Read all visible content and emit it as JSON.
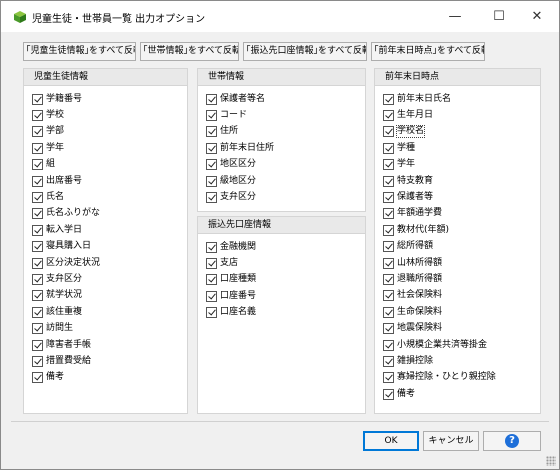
{
  "window": {
    "title": "児童生徒・世帯員一覧  出力オプション",
    "minimize_glyph": "—",
    "maximize_glyph": "☐",
    "close_glyph": "✕",
    "icon": "app-cube-icon"
  },
  "toolbar": {
    "btn_students": "｢児童生徒情報｣をすべて反転",
    "btn_household": "｢世帯情報｣をすべて反転",
    "btn_bank": "｢振込先口座情報｣をすべて反転",
    "btn_prevyear": "｢前年末日時点｣をすべて反転"
  },
  "panels": {
    "students": {
      "title": "児童生徒情報",
      "items": [
        {
          "label": "学籍番号",
          "checked": true
        },
        {
          "label": "学校",
          "checked": true
        },
        {
          "label": "学部",
          "checked": true
        },
        {
          "label": "学年",
          "checked": true
        },
        {
          "label": "組",
          "checked": true
        },
        {
          "label": "出席番号",
          "checked": true
        },
        {
          "label": "氏名",
          "checked": true
        },
        {
          "label": "氏名ふりがな",
          "checked": true
        },
        {
          "label": "転入学日",
          "checked": true
        },
        {
          "label": "寝具購入日",
          "checked": true
        },
        {
          "label": "区分決定状況",
          "checked": true
        },
        {
          "label": "支弁区分",
          "checked": true
        },
        {
          "label": "就学状況",
          "checked": true
        },
        {
          "label": "該住重複",
          "checked": true
        },
        {
          "label": "訪問生",
          "checked": true
        },
        {
          "label": "障害者手帳",
          "checked": true
        },
        {
          "label": "措置費受給",
          "checked": true
        },
        {
          "label": "備考",
          "checked": true
        }
      ]
    },
    "household": {
      "title": "世帯情報",
      "items": [
        {
          "label": "保護者等名",
          "checked": true
        },
        {
          "label": "コード",
          "checked": true
        },
        {
          "label": "住所",
          "checked": true
        },
        {
          "label": "前年末日住所",
          "checked": true
        },
        {
          "label": "地区区分",
          "checked": true
        },
        {
          "label": "級地区分",
          "checked": true
        },
        {
          "label": "支弁区分",
          "checked": true
        }
      ]
    },
    "bank": {
      "title": "振込先口座情報",
      "items": [
        {
          "label": "金融機関",
          "checked": true
        },
        {
          "label": "支店",
          "checked": true
        },
        {
          "label": "口座種類",
          "checked": true
        },
        {
          "label": "口座番号",
          "checked": true
        },
        {
          "label": "口座名義",
          "checked": true
        }
      ]
    },
    "prevyear": {
      "title": "前年末日時点",
      "items": [
        {
          "label": "前年末日氏名",
          "checked": true
        },
        {
          "label": "生年月日",
          "checked": true
        },
        {
          "label": "学校名",
          "checked": true
        },
        {
          "label": "学種",
          "checked": true
        },
        {
          "label": "学年",
          "checked": true
        },
        {
          "label": "特支教育",
          "checked": true
        },
        {
          "label": "保護者等",
          "checked": true
        },
        {
          "label": "年額通学費",
          "checked": true
        },
        {
          "label": "教材代(年額)",
          "checked": true
        },
        {
          "label": "総所得額",
          "checked": true
        },
        {
          "label": "山林所得額",
          "checked": true
        },
        {
          "label": "退職所得額",
          "checked": true
        },
        {
          "label": "社会保険料",
          "checked": true
        },
        {
          "label": "生命保険料",
          "checked": true
        },
        {
          "label": "地震保険料",
          "checked": true
        },
        {
          "label": "小規模企業共済等掛金",
          "checked": true
        },
        {
          "label": "雑損控除",
          "checked": true
        },
        {
          "label": "寡婦控除・ひとり親控除",
          "checked": true
        },
        {
          "label": "備考",
          "checked": true
        }
      ]
    }
  },
  "footer": {
    "ok": "OK",
    "cancel": "キャンセル",
    "help": "?"
  },
  "colors": {
    "accent": "#0078d7",
    "help_blue": "#1e6fd9",
    "panel_header": "#e9e9e9",
    "window_bg": "#f0f0f0"
  }
}
